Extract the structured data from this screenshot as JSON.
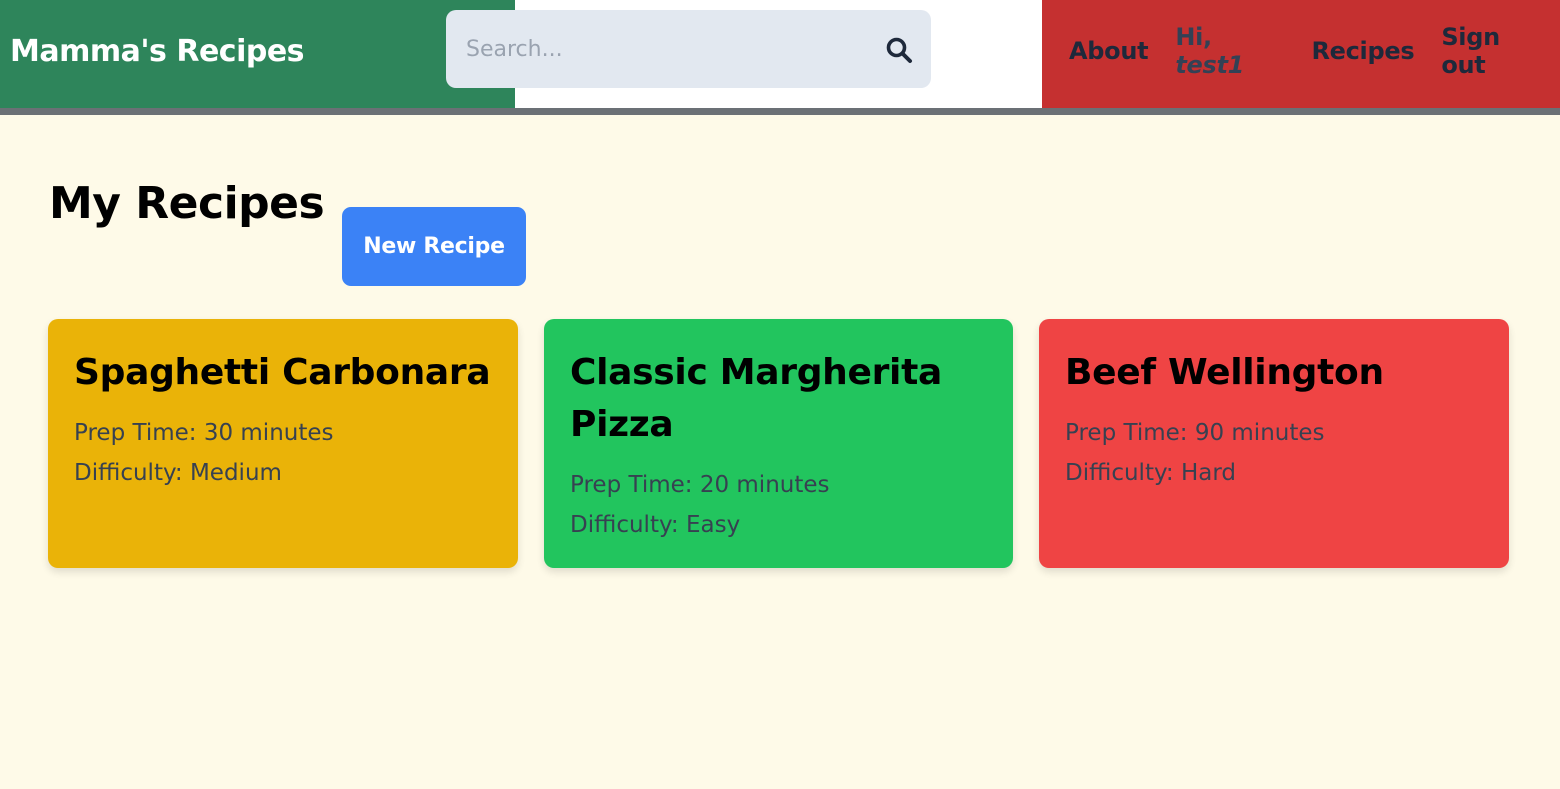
{
  "header": {
    "brand": "Mamma's Recipes",
    "search_placeholder": "Search...",
    "nav": {
      "about": "About",
      "greeting_prefix": "Hi, ",
      "username": "test1",
      "recipes": "Recipes",
      "sign_out": "Sign out"
    },
    "colors": {
      "left": "#2e855b",
      "middle": "#ffffff",
      "right": "#c53030"
    }
  },
  "main": {
    "title": "My Recipes",
    "new_recipe_label": "New Recipe",
    "recipes": [
      {
        "title": "Spaghetti Carbonara",
        "prep_time": "Prep Time: 30 minutes",
        "difficulty": "Difficulty: Medium",
        "color": "#eab308"
      },
      {
        "title": "Classic Margherita Pizza",
        "prep_time": "Prep Time: 20 minutes",
        "difficulty": "Difficulty: Easy",
        "color": "#22c55e"
      },
      {
        "title": "Beef Wellington",
        "prep_time": "Prep Time: 90 minutes",
        "difficulty": "Difficulty: Hard",
        "color": "#ef4444"
      }
    ]
  },
  "icons": {
    "search": "search-icon"
  }
}
